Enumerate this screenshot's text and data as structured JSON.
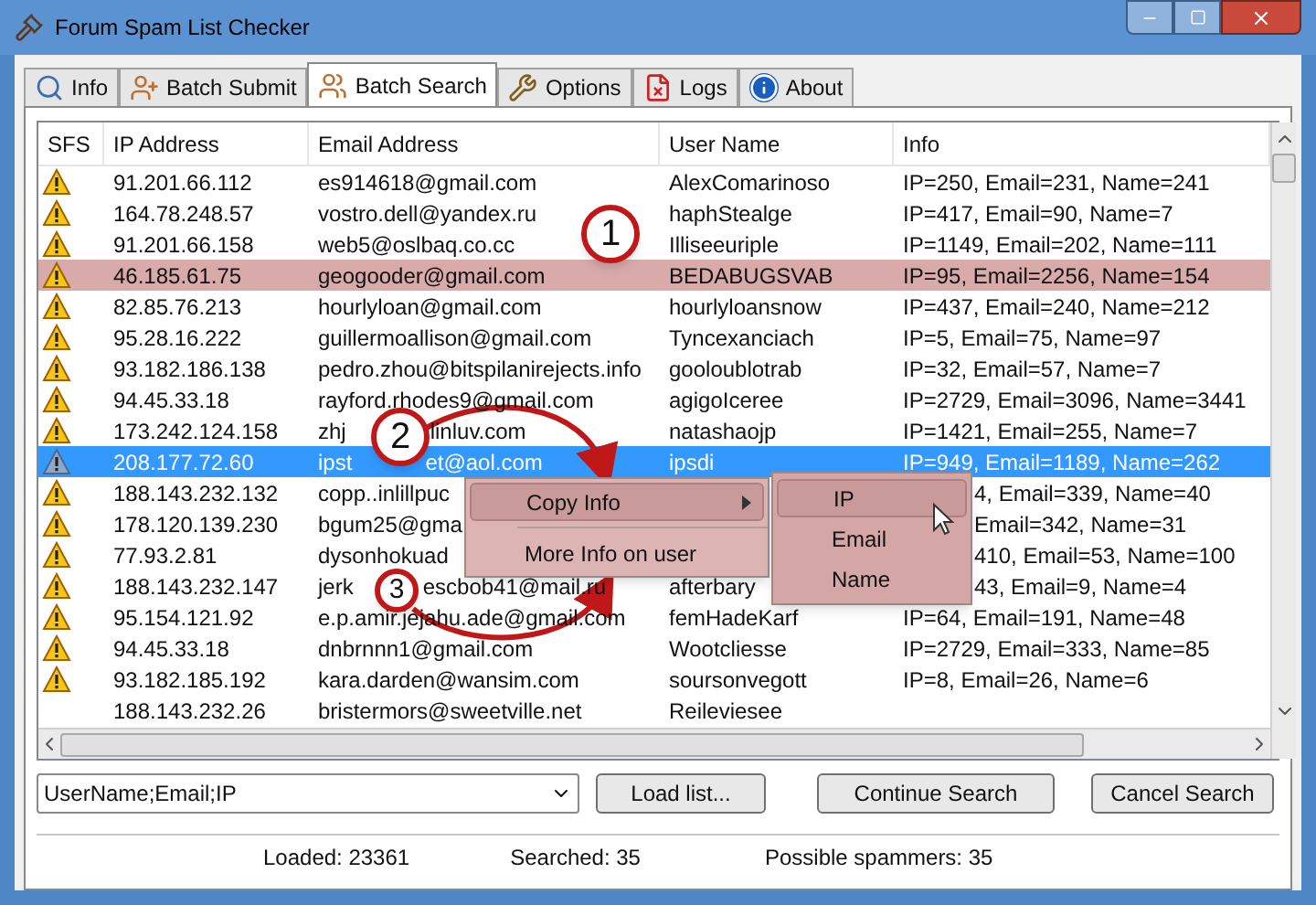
{
  "window": {
    "title": "Forum Spam List Checker"
  },
  "tabs": [
    {
      "label": "Info",
      "selected": false
    },
    {
      "label": "Batch Submit",
      "selected": false
    },
    {
      "label": "Batch Search",
      "selected": true
    },
    {
      "label": "Options",
      "selected": false
    },
    {
      "label": "Logs",
      "selected": false
    },
    {
      "label": "About",
      "selected": false
    }
  ],
  "table": {
    "columns": [
      "SFS",
      "IP Address",
      "Email Address",
      "User Name",
      "Info"
    ],
    "rows": [
      {
        "flagged": true,
        "selected": false,
        "highlighted": false,
        "ip": "91.201.66.112",
        "email": [
          "es914618@gmail.com"
        ],
        "user": "AlexComarinoso",
        "info": "IP=250, Email=231, Name=241",
        "info_cut": false
      },
      {
        "flagged": true,
        "selected": false,
        "highlighted": false,
        "ip": "164.78.248.57",
        "email": [
          "vostro.dell@yandex.ru"
        ],
        "user": "haphStealge",
        "info": "IP=417, Email=90, Name=7",
        "info_cut": false
      },
      {
        "flagged": true,
        "selected": false,
        "highlighted": false,
        "ip": "91.201.66.158",
        "email": [
          "web5@oslbaq.co.cc"
        ],
        "user": "Illiseeuriple",
        "info": "IP=1149, Email=202, Name=111",
        "info_cut": false
      },
      {
        "flagged": true,
        "selected": false,
        "highlighted": true,
        "ip": "46.185.61.75",
        "email": [
          "geogooder@gmail.com"
        ],
        "user": "BEDABUGSVAB",
        "info": "IP=95, Email=2256, Name=154",
        "info_cut": false
      },
      {
        "flagged": true,
        "selected": false,
        "highlighted": false,
        "ip": "82.85.76.213",
        "email": [
          "hourlyloan@gmail.com"
        ],
        "user": "hourlyloansnow",
        "info": "IP=437, Email=240, Name=212",
        "info_cut": false
      },
      {
        "flagged": true,
        "selected": false,
        "highlighted": false,
        "ip": "95.28.16.222",
        "email": [
          "guillermoallison@gmail.com"
        ],
        "user": "Tyncexanciach",
        "info": "IP=5, Email=75, Name=97",
        "info_cut": false
      },
      {
        "flagged": true,
        "selected": false,
        "highlighted": false,
        "ip": "93.182.186.138",
        "email": [
          "pedro.zhou@bitspilanirejects.info"
        ],
        "user": "gooloublotrab",
        "info": "IP=32, Email=57, Name=7",
        "info_cut": false
      },
      {
        "flagged": true,
        "selected": false,
        "highlighted": false,
        "ip": "94.45.33.18",
        "email": [
          "rayford.rhodes9@gmail.com"
        ],
        "user": "agigoIceree",
        "info": "IP=2729, Email=3096, Name=3441",
        "info_cut": false
      },
      {
        "flagged": true,
        "selected": false,
        "highlighted": false,
        "ip": "173.242.124.158",
        "email": [
          "zhj",
          "linluv.com"
        ],
        "user": "natashaojp",
        "info": "IP=1421, Email=255, Name=7",
        "info_cut": false
      },
      {
        "flagged": true,
        "selected": true,
        "highlighted": false,
        "ip": "208.177.72.60",
        "email": [
          "ipst",
          "et@aol.com"
        ],
        "user": "ipsdi",
        "info": "IP=949, Email=1189, Name=262",
        "info_cut": false
      },
      {
        "flagged": true,
        "selected": false,
        "highlighted": false,
        "ip": "188.143.232.132",
        "email": [
          "copp..inlillpuc"
        ],
        "info": "4, Email=339, Name=40",
        "info_cut": true
      },
      {
        "flagged": true,
        "selected": false,
        "highlighted": false,
        "ip": "178.120.139.230",
        "email": [
          "bgum25@gma"
        ],
        "info": "Email=342, Name=31",
        "info_cut": true
      },
      {
        "flagged": true,
        "selected": false,
        "highlighted": false,
        "ip": "77.93.2.81",
        "email": [
          "dysonhokuad"
        ],
        "info": "410, Email=53, Name=100",
        "info_cut": true
      },
      {
        "flagged": true,
        "selected": false,
        "highlighted": false,
        "ip": "188.143.232.147",
        "email": [
          "jerk",
          "escbob41@mail.ru"
        ],
        "user": "afterbary",
        "info": "43, Email=9, Name=4",
        "info_cut": true
      },
      {
        "flagged": true,
        "selected": false,
        "highlighted": false,
        "ip": "95.154.121.92",
        "email": [
          "e.p.amir.jejahu.ade@gmail.com"
        ],
        "user": "femHadeKarf",
        "info": "IP=64, Email=191, Name=48",
        "info_cut": false
      },
      {
        "flagged": true,
        "selected": false,
        "highlighted": false,
        "ip": "94.45.33.18",
        "email": [
          "dnbrnnn1@gmail.com"
        ],
        "user": "Wootcliesse",
        "info": "IP=2729, Email=333, Name=85",
        "info_cut": false
      },
      {
        "flagged": true,
        "selected": false,
        "highlighted": false,
        "ip": "93.182.185.192",
        "email": [
          "kara.darden@wansim.com"
        ],
        "user": "soursonvegott",
        "info": "IP=8, Email=26, Name=6",
        "info_cut": false
      },
      {
        "flagged": false,
        "selected": false,
        "highlighted": false,
        "ip": "188.143.232.26",
        "email": [
          "bristermors@sweetville.net"
        ],
        "user": "Reileviesee"
      }
    ]
  },
  "context_menu": {
    "items": [
      {
        "kind": "submenu",
        "label": "Copy Info",
        "highlighted": true
      },
      {
        "kind": "separator"
      },
      {
        "kind": "item",
        "label": "More Info on user",
        "highlighted": false
      }
    ],
    "submenu": [
      {
        "label": "IP",
        "highlighted": true
      },
      {
        "label": "Email",
        "highlighted": false
      },
      {
        "label": "Name",
        "highlighted": false
      }
    ]
  },
  "callouts": [
    "1",
    "2",
    "3"
  ],
  "controls": {
    "filter": "UserName;Email;IP",
    "buttons": [
      "Load list...",
      "Continue Search",
      "Cancel Search"
    ]
  },
  "status_bar": [
    "Loaded: 23361",
    "Searched: 35",
    "Possible spammers: 35"
  ]
}
